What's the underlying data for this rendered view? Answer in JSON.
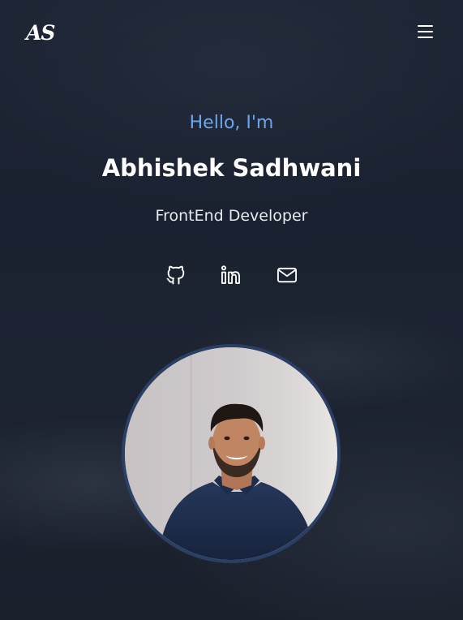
{
  "header": {
    "logo_text": "AS",
    "menu_icon": "hamburger-menu-icon"
  },
  "hero": {
    "greeting": "Hello, I'm",
    "name": "Abhishek Sadhwani",
    "role": "FrontEnd Developer"
  },
  "socials": [
    {
      "icon": "github-icon"
    },
    {
      "icon": "linkedin-icon"
    },
    {
      "icon": "mail-icon"
    }
  ],
  "colors": {
    "accent": "#6aa6f0",
    "background": "#1b2230",
    "avatar_border": "#2a3f63"
  }
}
